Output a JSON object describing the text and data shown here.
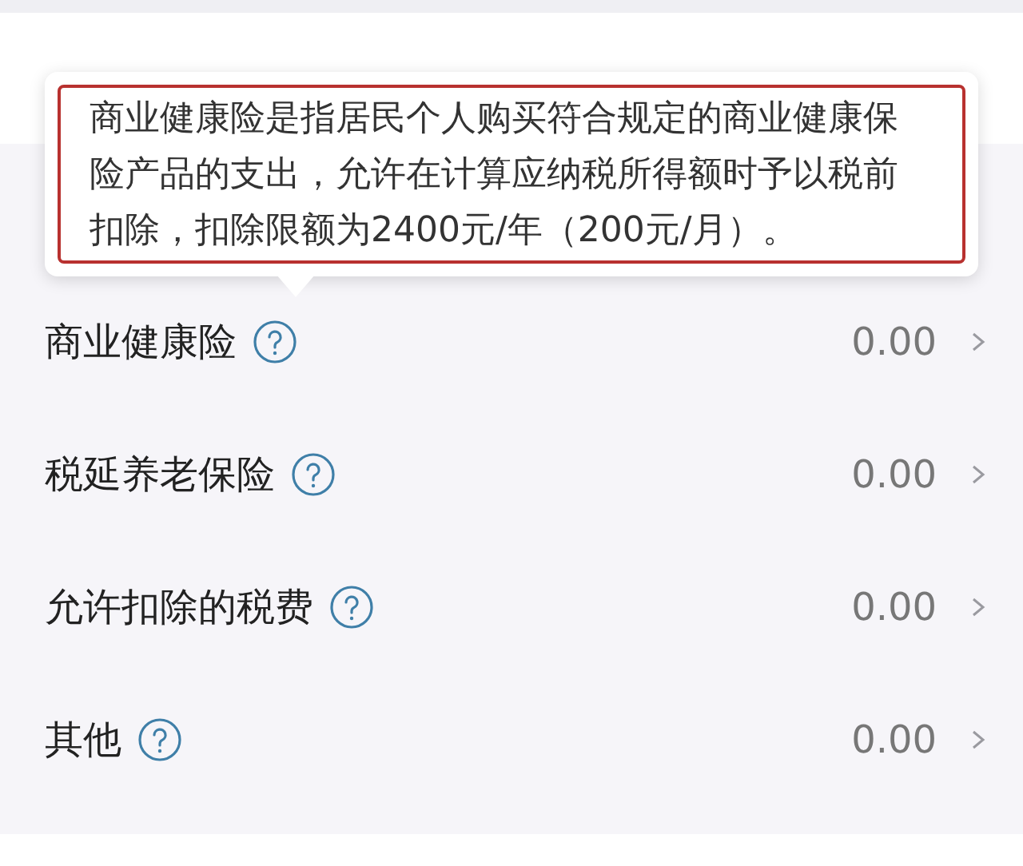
{
  "tooltip": {
    "text": "商业健康险是指居民个人购买符合规定的商业健康保险产品的支出，允许在计算应纳税所得额时予以税前扣除，扣除限额为2400元/年（200元/月）。"
  },
  "items": [
    {
      "label": "商业健康险",
      "value": "0.00"
    },
    {
      "label": "税延养老保险",
      "value": "0.00"
    },
    {
      "label": "允许扣除的税费",
      "value": "0.00"
    },
    {
      "label": "其他",
      "value": "0.00"
    }
  ]
}
